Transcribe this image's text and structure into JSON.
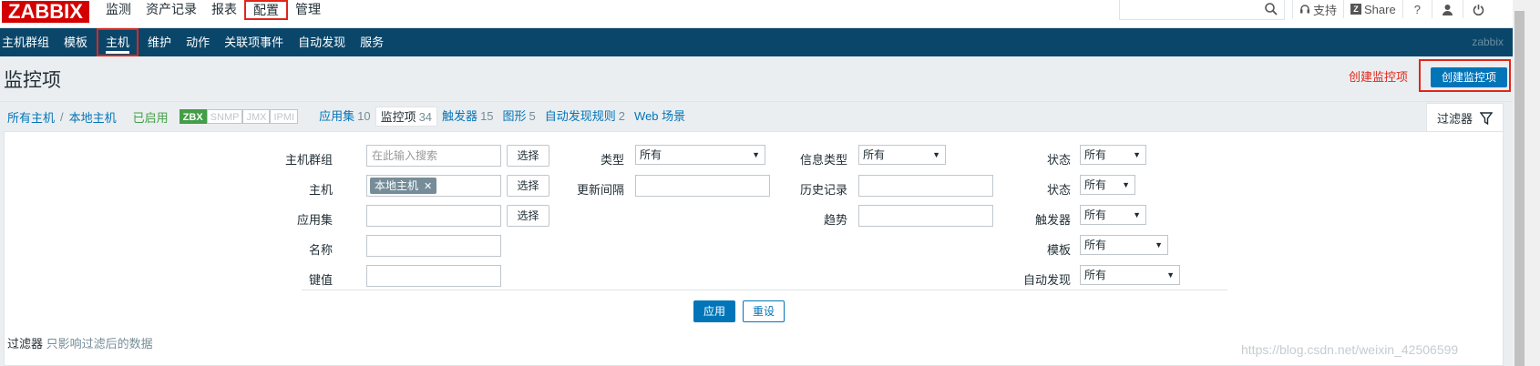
{
  "topbar": {
    "logo": "ZABBIX",
    "nav": [
      "监测",
      "资产记录",
      "报表",
      "配置",
      "管理"
    ],
    "support": "支持",
    "share": "Share",
    "help": "?",
    "share_icon_letter": "Z"
  },
  "subnav": {
    "items": [
      "主机群组",
      "模板",
      "主机",
      "维护",
      "动作",
      "关联项事件",
      "自动发现",
      "服务"
    ],
    "brand": "zabbix"
  },
  "header": {
    "title": "监控项",
    "create_hint": "创建监控项",
    "create_button": "创建监控项"
  },
  "crumbs": {
    "all_hosts": "所有主机",
    "sep": "/",
    "host": "本地主机",
    "enabled": "已启用",
    "tags": [
      "ZBX",
      "SNMP",
      "JMX",
      "IPMI"
    ],
    "tabs": [
      {
        "label": "应用集",
        "count": "10"
      },
      {
        "label": "监控项",
        "count": "34"
      },
      {
        "label": "触发器",
        "count": "15"
      },
      {
        "label": "图形",
        "count": "5"
      },
      {
        "label": "自动发现规则",
        "count": "2"
      },
      {
        "label": "Web 场景",
        "count": ""
      }
    ],
    "filter_tab": "过滤器"
  },
  "filter": {
    "host_group_label": "主机群组",
    "host_group_placeholder": "在此输入搜索",
    "select": "选择",
    "host_label": "主机",
    "host_chip": "本地主机",
    "app_label": "应用集",
    "name_label": "名称",
    "key_label": "键值",
    "type_label": "类型",
    "type_value": "所有",
    "interval_label": "更新间隔",
    "info_type_label": "信息类型",
    "info_type_value": "所有",
    "history_label": "历史记录",
    "trend_label": "趋势",
    "state_label": "状态",
    "state_value": "所有",
    "status_label": "状态",
    "status_value": "所有",
    "trigger_label": "触发器",
    "trigger_value": "所有",
    "template_label": "模板",
    "template_value": "所有",
    "discovery_label": "自动发现",
    "discovery_value": "所有",
    "apply": "应用",
    "reset": "重设"
  },
  "footer": {
    "filter_label": "过滤器",
    "filter_note": "只影响过滤后的数据",
    "watermark": "https://blog.csdn.net/weixin_42506599"
  }
}
